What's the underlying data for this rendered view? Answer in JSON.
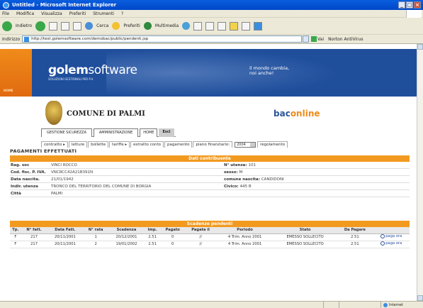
{
  "window": {
    "title": "Untitled - Microsoft Internet Explorer"
  },
  "menu": [
    "File",
    "Modifica",
    "Visualizza",
    "Preferiti",
    "Strumenti",
    "?"
  ],
  "toolbar": {
    "back": "Indietro",
    "search": "Cerca",
    "favorites": "Preferiti",
    "media": "Multimedia"
  },
  "address": {
    "label": "Indirizzo",
    "url": "http://test.golemsoftware.com/demobac/public/pendenti.jsp",
    "go": "Vai",
    "norton": "Norton AntiVirus"
  },
  "banner": {
    "brand_bold": "golem",
    "brand_light": "software",
    "brand_sub": "SOLUZIONI GESTIONALI PER P.A.",
    "motto_line1": "il mondo cambia,",
    "motto_line2": "noi anche!",
    "home": "HOME"
  },
  "header": {
    "comune": "COMUNE DI PALMI",
    "bac": "bac",
    "online": "online"
  },
  "menu_tabs": [
    "GESTIONE SICUREZZA",
    "AMMINISTRAZIONE",
    "HOME",
    "Esci"
  ],
  "sub_tabs": {
    "items": [
      "contratto",
      "letture",
      "bollette",
      "tariffe",
      "estratto conto",
      "pagamento"
    ],
    "piano_label": "piano finanziario:",
    "piano_value": "2004",
    "regolamento": "regolamento"
  },
  "page_heading": "PAGAMENTI EFFETTUATI",
  "contribuente": {
    "title": "Dati contribuente",
    "rows": [
      {
        "label": "Rag. soc",
        "value": "VINCI ROCCO",
        "label2": "N° utenza:",
        "value2": "101"
      },
      {
        "label": "Cod. fisc. P. IVA.",
        "value": "VNCRCC42A21B391N",
        "label2": "sesso:",
        "value2": "M"
      },
      {
        "label": "Data nascita.",
        "value": "21/01/1942",
        "label2": "comune nascita:",
        "value2": "CANDIDONI"
      },
      {
        "label": "Indir. utenza",
        "value": "TRONCO DEL TERRITORIO DEL COMUNE DI BORGIA",
        "label2": "Civico:",
        "value2": "445 B"
      },
      {
        "label": "Città",
        "value": "PALMI",
        "label2": "",
        "value2": ""
      }
    ]
  },
  "scadenze": {
    "title": "Scadenze pendenti",
    "columns": [
      "Tp.",
      "N° fatt.",
      "Data Fatt.",
      "N° rata",
      "Scadenza",
      "Imp.",
      "Pagato",
      "Pagata il",
      "Periodo",
      "Stato",
      "Da Pagare",
      ""
    ],
    "rows": [
      [
        "F",
        "217",
        "20/11/2001",
        "1",
        "20/12/2001",
        "2.51",
        "0",
        "//",
        "4 Trim. Anno 2001",
        "EMESSO SOLLECITO",
        "2.51",
        "paga ora"
      ],
      [
        "F",
        "217",
        "20/11/2001",
        "2",
        "19/01/2002",
        "2.51",
        "0",
        "//",
        "4 Trim. Anno 2001",
        "EMESSO SOLLECITO",
        "2.51",
        "paga ora"
      ]
    ]
  },
  "status": {
    "zone": "Internet"
  }
}
